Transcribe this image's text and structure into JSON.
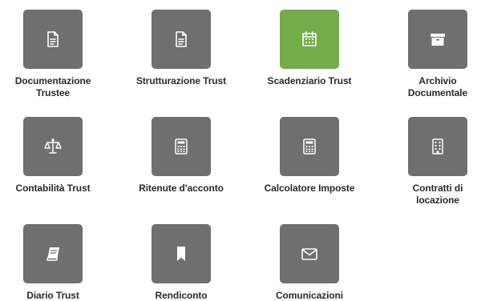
{
  "tiles": [
    {
      "label": "Documentazione\nTrustee",
      "icon": "document-icon",
      "active": false
    },
    {
      "label": "Strutturazione Trust",
      "icon": "document-icon",
      "active": false
    },
    {
      "label": "Scadenziario Trust",
      "icon": "calendar-icon",
      "active": true
    },
    {
      "label": "Archivio\nDocumentale",
      "icon": "archive-box-icon",
      "active": false
    },
    {
      "label": "Contabilità Trust",
      "icon": "balance-scale-icon",
      "active": false
    },
    {
      "label": "Ritenute d'acconto",
      "icon": "calculator-icon",
      "active": false
    },
    {
      "label": "Calcolatore Imposte",
      "icon": "calculator-icon",
      "active": false
    },
    {
      "label": "Contratti di\nlocazione",
      "icon": "building-icon",
      "active": false
    },
    {
      "label": "Diario Trust",
      "icon": "book-icon",
      "active": false
    },
    {
      "label": "Rendiconto",
      "icon": "bookmark-icon",
      "active": false
    },
    {
      "label": "Comunicazioni",
      "icon": "envelope-icon",
      "active": false
    }
  ],
  "colors": {
    "tile_background": "#6f6f6f",
    "tile_active_background": "#72ad4a",
    "icon_color": "#ffffff",
    "label_color": "#2b2b2b"
  }
}
